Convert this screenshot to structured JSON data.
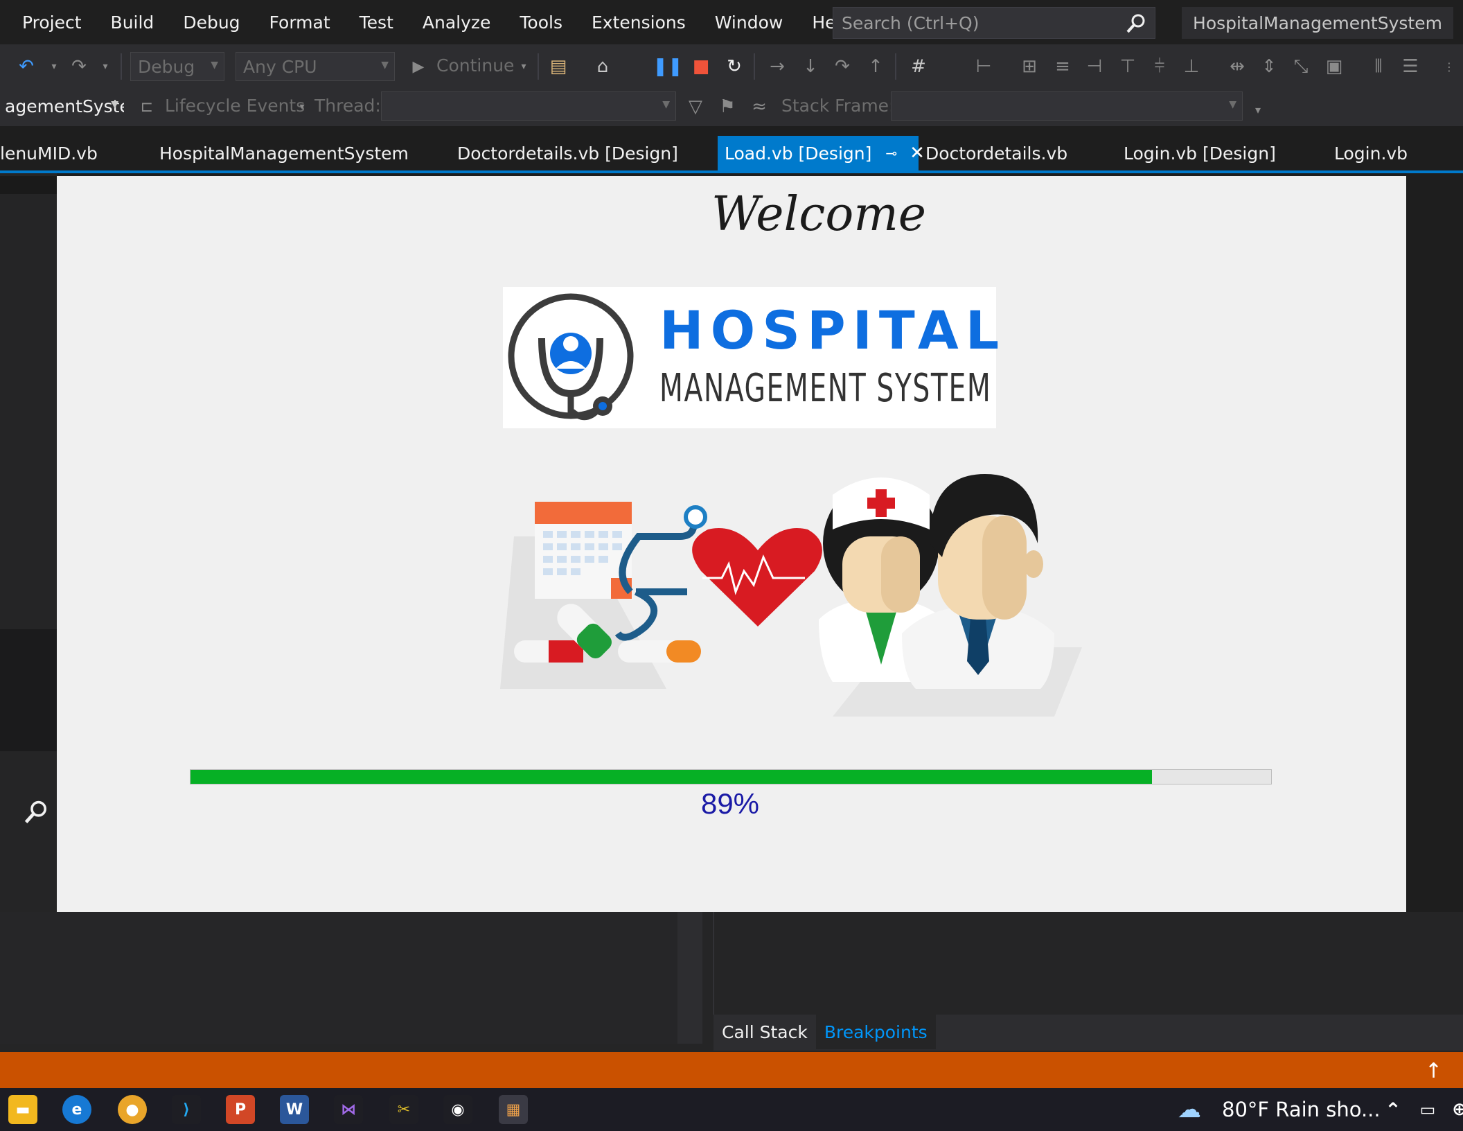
{
  "menu": {
    "items": [
      "Project",
      "Build",
      "Debug",
      "Format",
      "Test",
      "Analyze",
      "Tools",
      "Extensions",
      "Window",
      "Help"
    ],
    "search_placeholder": "Search (Ctrl+Q)",
    "solution_name": "HospitalManagementSystem"
  },
  "toolbar1": {
    "config": "Debug",
    "platform": "Any CPU",
    "continue_label": "Continue"
  },
  "toolbar2": {
    "process": "agementSyste",
    "lifecycle": "Lifecycle Events",
    "thread_label": "Thread:",
    "stack_frame_label": "Stack Frame:"
  },
  "tabs": [
    {
      "label": "lenuMID.vb"
    },
    {
      "label": "HospitalManagementSystem"
    },
    {
      "label": "Doctordetails.vb [Design]"
    },
    {
      "label": "Load.vb [Design]",
      "active": true
    },
    {
      "label": "Doctordetails.vb"
    },
    {
      "label": "Login.vb [Design]"
    },
    {
      "label": "Login.vb"
    }
  ],
  "form": {
    "welcome": "Welcome",
    "logo_title": "HOSPITAL",
    "logo_subtitle": "MANAGEMENT SYSTEM",
    "progress": {
      "value": 0.89,
      "label": "89%"
    },
    "colors": {
      "logo_blue": "#0e6ee0",
      "progress_green": "#06b025",
      "label_blue": "#1a1aa6"
    }
  },
  "bottom_tabs": [
    {
      "label": "Call Stack"
    },
    {
      "label": "Breakpoints",
      "active": true
    }
  ],
  "statusbar": {
    "color": "#ca5100"
  },
  "taskbar": {
    "weather": "80°F  Rain sho..."
  }
}
